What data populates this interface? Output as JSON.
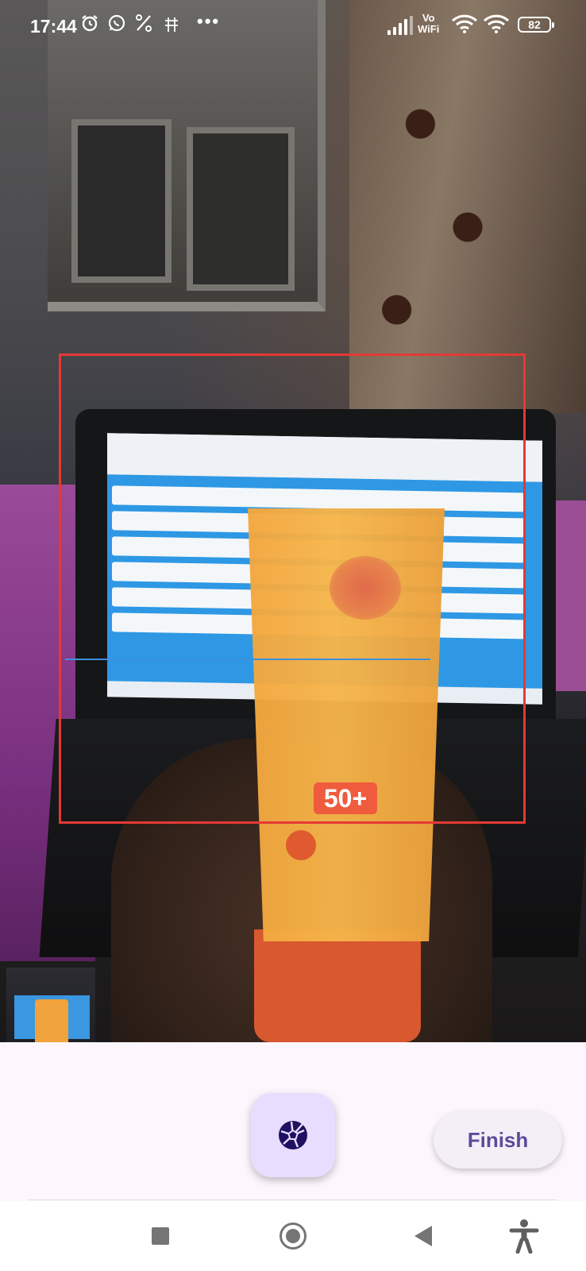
{
  "status_bar": {
    "time": "17:44",
    "alarm_icon": "alarm-clock-icon",
    "whatsapp_icon": "whatsapp-icon",
    "network_icon": "network-blocked-icon",
    "pay_icon": "pay-icon",
    "more_dots": "•••",
    "vowifi_top": "Vo",
    "vowifi_bottom": "WiFi",
    "battery_level": "82"
  },
  "camera": {
    "scan_box_color": "#e53935",
    "scan_line_color": "#3d8fdc",
    "product_spf_text": "50+"
  },
  "controls": {
    "shutter_icon": "camera-aperture-icon",
    "finish_label": "Finish",
    "accent_color": "#5c4a9c",
    "shutter_bg_color": "#e9ddff"
  },
  "nav_bar": {
    "recents_icon": "square-icon",
    "home_icon": "circle-home-icon",
    "back_icon": "triangle-back-icon",
    "accessibility_icon": "accessibility-person-icon"
  }
}
